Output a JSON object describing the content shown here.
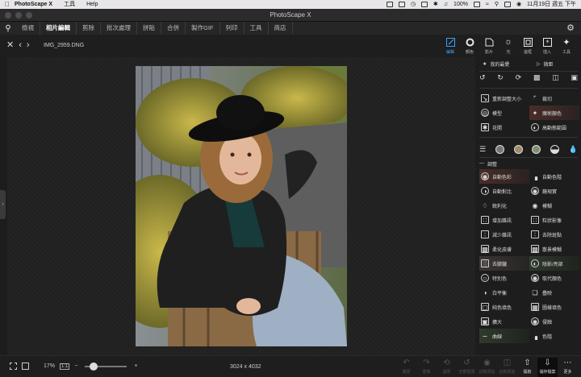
{
  "menubar": {
    "app": "PhotoScape X",
    "menus": [
      "工具",
      "Help"
    ],
    "battery": "100%",
    "clock": "11月19日 週五 下午"
  },
  "window": {
    "title": "PhotoScape X"
  },
  "tabs": [
    {
      "label": "檢視"
    },
    {
      "label": "相片編輯"
    },
    {
      "label": "剪除"
    },
    {
      "label": "批次處理"
    },
    {
      "label": "拼貼"
    },
    {
      "label": "合併"
    },
    {
      "label": "製作GIF"
    },
    {
      "label": "列印"
    },
    {
      "label": "工具"
    },
    {
      "label": "商店"
    }
  ],
  "active_tab_index": 1,
  "editor": {
    "filename": "IMG_2959.DNG",
    "tools": [
      {
        "label": "編輯",
        "icon": "pencil-edit-icon"
      },
      {
        "label": "顏色",
        "icon": "color-ring-icon"
      },
      {
        "label": "影片",
        "icon": "film-icon"
      },
      {
        "label": "光",
        "icon": "sun-icon"
      },
      {
        "label": "邊框",
        "icon": "frame-icon"
      },
      {
        "label": "插入",
        "icon": "insert-star-icon"
      },
      {
        "label": "工具",
        "icon": "tools-icon"
      }
    ]
  },
  "panel": {
    "favorites": "我的最愛",
    "macro": "微距",
    "row1": [
      {
        "label": "重新調整大小",
        "icon": "resize-icon"
      },
      {
        "label": "裁切",
        "icon": "crop-icon"
      },
      {
        "label": "模型",
        "icon": "model-icon"
      },
      {
        "label": "魔術顏色",
        "icon": "magic-wand-icon"
      },
      {
        "label": "花開",
        "icon": "bloom-icon"
      },
      {
        "label": "高動態範圍",
        "icon": "hdr-icon"
      }
    ],
    "adjust_header": "調整",
    "adjust": [
      {
        "label": "自動色彩",
        "icon": "auto-color-icon"
      },
      {
        "label": "自動色階",
        "icon": "auto-levels-icon"
      },
      {
        "label": "自動對比",
        "icon": "auto-contrast-icon"
      },
      {
        "label": "鏡現實",
        "icon": "reality-icon"
      },
      {
        "label": "銳利化",
        "icon": "sharpen-icon"
      },
      {
        "label": "模糊",
        "icon": "blur-drop-icon"
      },
      {
        "label": "增加雜訊",
        "icon": "add-noise-icon"
      },
      {
        "label": "粒狀影像",
        "icon": "grain-icon"
      },
      {
        "label": "減少雜訊",
        "icon": "reduce-noise-icon"
      },
      {
        "label": "去除斑點",
        "icon": "despeckle-icon"
      },
      {
        "label": "柔化皮膚",
        "icon": "soften-skin-icon"
      },
      {
        "label": "散景模糊",
        "icon": "bokeh-icon"
      },
      {
        "label": "去朦朧",
        "icon": "dehaze-icon"
      },
      {
        "label": "陰影/亮部",
        "icon": "shadow-highlight-icon"
      },
      {
        "label": "特別色",
        "icon": "spot-color-icon"
      },
      {
        "label": "取代顏色",
        "icon": "replace-color-icon"
      },
      {
        "label": "白平衡",
        "icon": "white-balance-icon"
      },
      {
        "label": "疊映",
        "icon": "overlay-icon"
      },
      {
        "label": "純色填色",
        "icon": "solid-fill-icon"
      },
      {
        "label": "圖樣填色",
        "icon": "pattern-fill-icon"
      },
      {
        "label": "擴大",
        "icon": "expand-icon"
      },
      {
        "label": "侵蝕",
        "icon": "erode-icon"
      },
      {
        "label": "曲線",
        "icon": "curves-icon"
      },
      {
        "label": "色階",
        "icon": "levels-icon"
      }
    ]
  },
  "bottom": {
    "zoom": "17%",
    "one_to_one": "1:1",
    "zoom_level": 0.2,
    "minus": "−",
    "plus": "+",
    "dimensions": "3024 x 4032",
    "buttons": [
      {
        "label": "復原",
        "icon": "undo-icon",
        "enabled": false
      },
      {
        "label": "重做",
        "icon": "redo-icon",
        "enabled": false
      },
      {
        "label": "還原",
        "icon": "revert-icon",
        "enabled": false
      },
      {
        "label": "全部復原",
        "icon": "undo-all-icon",
        "enabled": false
      },
      {
        "label": "比較原始",
        "icon": "compare-icon",
        "enabled": false
      },
      {
        "label": "比較原始",
        "icon": "compare-split-icon",
        "enabled": false
      },
      {
        "label": "開啟",
        "icon": "share-icon",
        "enabled": true
      },
      {
        "label": "儲存檔案",
        "icon": "save-download-icon",
        "enabled": true
      },
      {
        "label": "更多",
        "icon": "more-icon",
        "enabled": true
      }
    ]
  }
}
